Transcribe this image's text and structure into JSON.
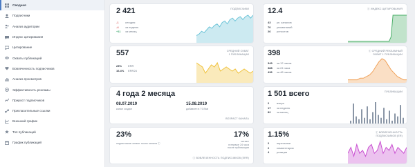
{
  "sidebar": {
    "items": [
      {
        "label": "Сводная",
        "icon": "dashboard-icon",
        "active": true
      },
      {
        "label": "Подписчики",
        "icon": "users-icon"
      },
      {
        "label": "Анализ аудитории",
        "icon": "audience-icon"
      },
      {
        "label": "Индекс цитирования",
        "icon": "quote-icon"
      },
      {
        "label": "Цитирование",
        "icon": "chat-icon"
      },
      {
        "label": "Охваты публикаций",
        "icon": "eye-icon"
      },
      {
        "label": "Вовлеченность подписчиков",
        "icon": "heart-icon"
      },
      {
        "label": "Анализ просмотров",
        "icon": "bar-icon"
      },
      {
        "label": "Эффективность рекламы",
        "icon": "target-icon"
      },
      {
        "label": "Прирост подписчиков",
        "icon": "growth-icon"
      },
      {
        "label": "Пригласительные ссылки",
        "icon": "link-icon"
      },
      {
        "label": "Внешний график",
        "icon": "chart-icon"
      },
      {
        "label": "Топ публикаций",
        "icon": "star-icon"
      },
      {
        "label": "График публикаций",
        "icon": "calendar-icon"
      }
    ]
  },
  "subscribers": {
    "value": "2 421",
    "label": "ПОДПИСЧИКИ",
    "rows": [
      {
        "value": "-1",
        "text": "сегодня",
        "tone": "neg"
      },
      {
        "value": "-4",
        "text": "за неделю",
        "tone": "neg"
      },
      {
        "value": "+11",
        "text": "за месяц",
        "tone": "pos"
      }
    ],
    "chart_data": {
      "type": "area",
      "color": "#6cc4d8",
      "values": [
        4,
        5,
        7,
        6,
        8,
        10,
        9,
        11,
        12,
        10,
        13,
        14,
        12,
        15,
        16,
        14,
        16,
        17,
        15,
        17,
        18,
        16,
        18
      ]
    }
  },
  "citation": {
    "value": "12.4",
    "label": "ИНДЕКС ЦИТИРОВАНИЯ",
    "rows": [
      {
        "value": "43",
        "text": "уп. каналов"
      },
      {
        "value": "70",
        "text": "упоминаний"
      },
      {
        "value": "26",
        "text": "репостов"
      }
    ],
    "chart_data": {
      "type": "area",
      "color": "#4caf6a",
      "values": [
        0,
        0,
        0,
        0,
        0,
        0,
        0,
        0,
        0,
        0,
        0,
        0,
        0,
        0,
        0,
        0,
        0,
        0,
        0,
        0,
        0,
        0,
        2,
        12,
        12,
        12,
        12,
        12,
        12,
        12,
        12
      ]
    }
  },
  "reach": {
    "value": "557",
    "label": "СРЕДНИЙ ОХВАТ\n1 ПУБЛИКАЦИИ",
    "err_rows": [
      {
        "value": "23%",
        "text": "ERR"
      },
      {
        "value": "16.4%",
        "text": "ERR24"
      }
    ],
    "chart_data": {
      "type": "area",
      "color": "#f0c23c",
      "values": [
        9,
        8,
        7,
        4,
        6,
        8,
        7,
        9,
        5,
        6,
        7,
        6,
        5,
        6,
        4,
        5,
        6,
        5,
        4,
        5
      ]
    }
  },
  "ad_reach": {
    "value": "398",
    "label": "СРЕДНИЙ РЕКЛАМНЫЙ\nОХВАТ 1 ПУБЛИКАЦИИ",
    "rows": [
      {
        "value": "349",
        "text": "за 12 часов"
      },
      {
        "value": "388",
        "text": "за 24 часа"
      },
      {
        "value": "436",
        "text": "за 48 часов"
      }
    ],
    "chart_data": {
      "type": "area",
      "color": "#f0a25a",
      "values": [
        1,
        1,
        1,
        1,
        2,
        2,
        3,
        4,
        6,
        9,
        12,
        14,
        13,
        10,
        7,
        5,
        3,
        2,
        1,
        1
      ]
    }
  },
  "age": {
    "value": "4 года 2 месяца",
    "created_date": "08.07.2019",
    "created_label": "канал создан",
    "added_date": "15.08.2019",
    "added_label": "добавлен в TGStat",
    "label": "ВОЗРАСТ КАНАЛА"
  },
  "publications": {
    "value": "1 501 всего",
    "label": "ПУБЛИКАЦИИ",
    "rows": [
      {
        "value": "2",
        "text": "вчера"
      },
      {
        "value": "17",
        "text": "за неделю"
      },
      {
        "value": "82",
        "text": "за месяц"
      }
    ],
    "chart_data": {
      "type": "bar",
      "color": "#8a96a6",
      "values": [
        2,
        14,
        5,
        3,
        10,
        4,
        12,
        3,
        8,
        15,
        6,
        4,
        11,
        3,
        9,
        2,
        7,
        5,
        13,
        4
      ]
    }
  },
  "engagement": {
    "value1": "23%",
    "note1": "подписчиков читают посты канала",
    "value2": "17%",
    "note2": "читают\nв первые 24 часа\nпосле публикации",
    "footer": "ВОВЛЕЧЕННОСТЬ ПОДПИСЧИКОВ (ERR)"
  },
  "er": {
    "value": "1.15%",
    "label": "ВОВЛЕЧЕННОСТЬ\nПОДПИСЧИКОВ (ER)",
    "rows": [
      {
        "value": "2",
        "text": "пересылки"
      },
      {
        "value": "2",
        "text": "комментарии"
      },
      {
        "value": "4",
        "text": "реакции"
      }
    ],
    "chart_data": {
      "type": "area",
      "color": "#c94fd1",
      "values": [
        3,
        5,
        2,
        6,
        3,
        4,
        2,
        5,
        6,
        3,
        4,
        7,
        3,
        5,
        4,
        6,
        3,
        5,
        4,
        3,
        5
      ]
    }
  }
}
